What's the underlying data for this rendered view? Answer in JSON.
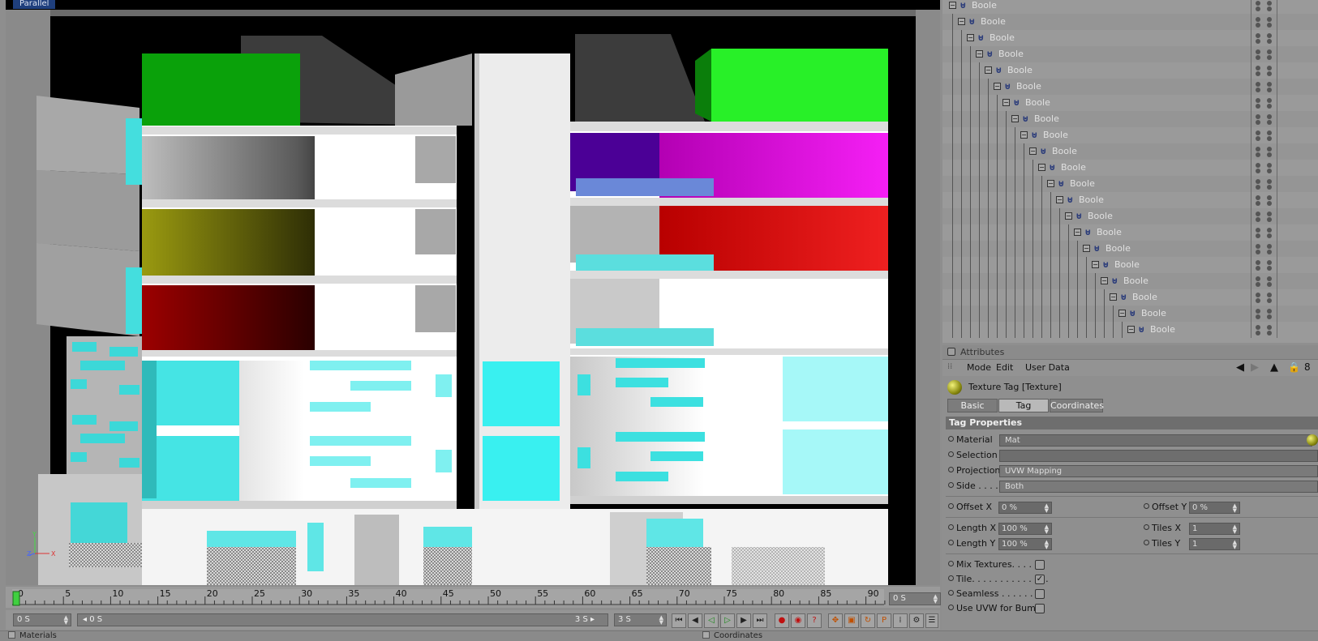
{
  "viewport": {
    "label": "Parallel",
    "axis_labels": {
      "x": "X",
      "y": "Y",
      "z": "Z"
    }
  },
  "timeline": {
    "ticks": [
      "0",
      "5",
      "10",
      "15",
      "20",
      "25",
      "30",
      "35",
      "40",
      "45",
      "50",
      "55",
      "60",
      "65",
      "70",
      "75",
      "80",
      "85",
      "90"
    ],
    "current_frame_field": "0 S"
  },
  "transport": {
    "start_field": "0 S",
    "range_start": "0 S",
    "range_end": "3 S",
    "end_field": "3 S"
  },
  "bottom_strip": {
    "materials_label": "Materials",
    "coordinates_label": "Coordinates"
  },
  "object_tree": {
    "items": [
      "Boole",
      "Boole",
      "Boole",
      "Boole",
      "Boole",
      "Boole",
      "Boole",
      "Boole",
      "Boole",
      "Boole",
      "Boole",
      "Boole",
      "Boole",
      "Boole",
      "Boole",
      "Boole",
      "Boole",
      "Boole",
      "Boole",
      "Boole",
      "Boole"
    ]
  },
  "attributes": {
    "header": "Attributes",
    "menu": {
      "mode": "Mode",
      "edit": "Edit",
      "user_data": "User Data"
    },
    "tag_title": "Texture Tag [Texture]",
    "tabs": [
      "Basic",
      "Tag",
      "Coordinates"
    ],
    "active_tab": "Tag",
    "section_title": "Tag Properties",
    "material_label": "Material",
    "material_value": "Mat",
    "selection_label": "Selection",
    "selection_value": "",
    "projection_label": "Projection",
    "projection_value": "UVW Mapping",
    "side_label": "Side . . . .",
    "side_value": "Both",
    "offset_x_label": "Offset X",
    "offset_x_value": "0 %",
    "offset_y_label": "Offset Y",
    "offset_y_value": "0 %",
    "length_x_label": "Length X",
    "length_x_value": "100 %",
    "tiles_x_label": "Tiles X",
    "tiles_x_value": "1",
    "length_y_label": "Length Y",
    "length_y_value": "100 %",
    "tiles_y_label": "Tiles Y",
    "tiles_y_value": "1",
    "mix_textures_label": "Mix Textures. . . . . .",
    "mix_textures_checked": false,
    "tile_label": "Tile. . . . . . . . . . . . . .",
    "tile_checked": true,
    "seamless_label": "Seamless . . . . . . . .",
    "seamless_checked": false,
    "use_uvw_bump_label": "Use UVW for Bump",
    "use_uvw_bump_checked": false
  },
  "colors": {
    "viewport_bg": "#000000",
    "panel_bg": "#8f8f8f",
    "accent_green": "#22ee22",
    "accent_magenta": "#ee22ee",
    "accent_cyan": "#33e6e6"
  }
}
